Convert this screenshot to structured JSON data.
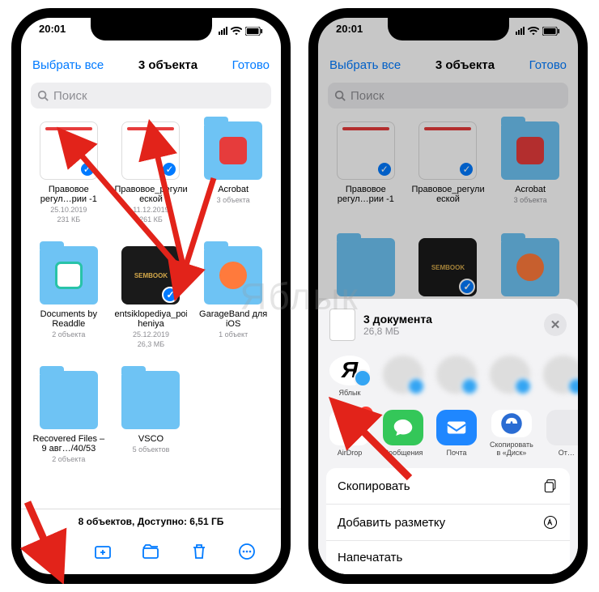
{
  "statusbar": {
    "time": "20:01"
  },
  "left": {
    "nav": {
      "select_all": "Выбрать все",
      "title": "3 объекта",
      "done": "Готово"
    },
    "search": {
      "placeholder": "Поиск"
    },
    "items": [
      {
        "name": "Правовое регул…рии -1",
        "date": "25.10.2019",
        "size": "231 КБ",
        "type": "doc",
        "selected": true
      },
      {
        "name": "Правовое_регулиро…еской",
        "date": "11.12.2019",
        "size": "261 КБ",
        "type": "doc",
        "selected": true
      },
      {
        "name": "Acrobat",
        "meta": "3 объекта",
        "type": "folder",
        "icon_color": "#e63c3c"
      },
      {
        "name": "Documents by Readdle",
        "meta": "2 объекта",
        "type": "folder",
        "icon_color": "#fff"
      },
      {
        "name": "entsiklopediya_poisko…heniya",
        "date": "25.12.2019",
        "size": "26,3 МБ",
        "type": "dark",
        "selected": true,
        "book_label": "SEMBOOK"
      },
      {
        "name": "GarageBand для iOS",
        "meta": "1 объект",
        "type": "folder",
        "icon_color": "#ff7a3c"
      },
      {
        "name": "Recovered Files – 9 авг…/40/53",
        "meta": "2 объекта",
        "type": "folder"
      },
      {
        "name": "VSCO",
        "meta": "5 объектов",
        "type": "folder"
      }
    ],
    "footer": "8 объектов, Доступно: 6,51 ГБ"
  },
  "right": {
    "nav": {
      "select_all": "Выбрать все",
      "title": "3 объекта",
      "done": "Готово"
    },
    "search": {
      "placeholder": "Поиск"
    },
    "items": [
      {
        "name": "Правовое регул…рии -1",
        "type": "doc",
        "selected": true
      },
      {
        "name": "Правовое_регулиро…еской",
        "type": "doc",
        "selected": true
      },
      {
        "name": "Acrobat",
        "meta": "3 объекта",
        "type": "folder",
        "icon_color": "#e63c3c"
      },
      {
        "name": "",
        "type": "folder"
      },
      {
        "name": "",
        "type": "dark",
        "selected": true,
        "book_label": "SEMBOOK"
      },
      {
        "name": "",
        "type": "folder",
        "icon_color": "#ff7a3c"
      }
    ],
    "sheet": {
      "title": "3 документа",
      "subtitle": "26,8 МБ",
      "contacts": [
        {
          "label": "Яблык"
        },
        {
          "label": ""
        },
        {
          "label": ""
        },
        {
          "label": ""
        },
        {
          "label": ""
        }
      ],
      "apps": [
        {
          "label": "AirDrop",
          "color": "#ffffff",
          "badge": "2"
        },
        {
          "label": "Сообщения",
          "color": "#34c759"
        },
        {
          "label": "Почта",
          "color": "#1f87ff"
        },
        {
          "label": "Скопировать в «Диск»",
          "color": "#ffffff"
        },
        {
          "label": "От…",
          "color": "#e9e9ec"
        }
      ],
      "actions": [
        {
          "label": "Скопировать",
          "icon": "copy"
        },
        {
          "label": "Добавить разметку",
          "icon": "markup"
        },
        {
          "label": "Напечатать",
          "icon": "print"
        }
      ]
    }
  },
  "watermark": "Яблык"
}
